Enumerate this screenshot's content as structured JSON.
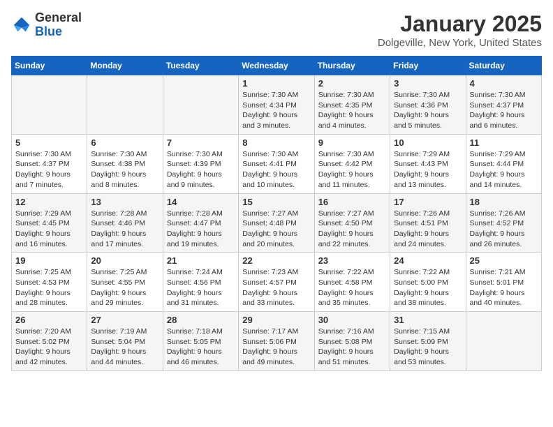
{
  "header": {
    "logo_general": "General",
    "logo_blue": "Blue",
    "month_title": "January 2025",
    "location": "Dolgeville, New York, United States"
  },
  "days_of_week": [
    "Sunday",
    "Monday",
    "Tuesday",
    "Wednesday",
    "Thursday",
    "Friday",
    "Saturday"
  ],
  "weeks": [
    [
      {
        "num": "",
        "info": ""
      },
      {
        "num": "",
        "info": ""
      },
      {
        "num": "",
        "info": ""
      },
      {
        "num": "1",
        "info": "Sunrise: 7:30 AM\nSunset: 4:34 PM\nDaylight: 9 hours and 3 minutes."
      },
      {
        "num": "2",
        "info": "Sunrise: 7:30 AM\nSunset: 4:35 PM\nDaylight: 9 hours and 4 minutes."
      },
      {
        "num": "3",
        "info": "Sunrise: 7:30 AM\nSunset: 4:36 PM\nDaylight: 9 hours and 5 minutes."
      },
      {
        "num": "4",
        "info": "Sunrise: 7:30 AM\nSunset: 4:37 PM\nDaylight: 9 hours and 6 minutes."
      }
    ],
    [
      {
        "num": "5",
        "info": "Sunrise: 7:30 AM\nSunset: 4:37 PM\nDaylight: 9 hours and 7 minutes."
      },
      {
        "num": "6",
        "info": "Sunrise: 7:30 AM\nSunset: 4:38 PM\nDaylight: 9 hours and 8 minutes."
      },
      {
        "num": "7",
        "info": "Sunrise: 7:30 AM\nSunset: 4:39 PM\nDaylight: 9 hours and 9 minutes."
      },
      {
        "num": "8",
        "info": "Sunrise: 7:30 AM\nSunset: 4:41 PM\nDaylight: 9 hours and 10 minutes."
      },
      {
        "num": "9",
        "info": "Sunrise: 7:30 AM\nSunset: 4:42 PM\nDaylight: 9 hours and 11 minutes."
      },
      {
        "num": "10",
        "info": "Sunrise: 7:29 AM\nSunset: 4:43 PM\nDaylight: 9 hours and 13 minutes."
      },
      {
        "num": "11",
        "info": "Sunrise: 7:29 AM\nSunset: 4:44 PM\nDaylight: 9 hours and 14 minutes."
      }
    ],
    [
      {
        "num": "12",
        "info": "Sunrise: 7:29 AM\nSunset: 4:45 PM\nDaylight: 9 hours and 16 minutes."
      },
      {
        "num": "13",
        "info": "Sunrise: 7:28 AM\nSunset: 4:46 PM\nDaylight: 9 hours and 17 minutes."
      },
      {
        "num": "14",
        "info": "Sunrise: 7:28 AM\nSunset: 4:47 PM\nDaylight: 9 hours and 19 minutes."
      },
      {
        "num": "15",
        "info": "Sunrise: 7:27 AM\nSunset: 4:48 PM\nDaylight: 9 hours and 20 minutes."
      },
      {
        "num": "16",
        "info": "Sunrise: 7:27 AM\nSunset: 4:50 PM\nDaylight: 9 hours and 22 minutes."
      },
      {
        "num": "17",
        "info": "Sunrise: 7:26 AM\nSunset: 4:51 PM\nDaylight: 9 hours and 24 minutes."
      },
      {
        "num": "18",
        "info": "Sunrise: 7:26 AM\nSunset: 4:52 PM\nDaylight: 9 hours and 26 minutes."
      }
    ],
    [
      {
        "num": "19",
        "info": "Sunrise: 7:25 AM\nSunset: 4:53 PM\nDaylight: 9 hours and 28 minutes."
      },
      {
        "num": "20",
        "info": "Sunrise: 7:25 AM\nSunset: 4:55 PM\nDaylight: 9 hours and 29 minutes."
      },
      {
        "num": "21",
        "info": "Sunrise: 7:24 AM\nSunset: 4:56 PM\nDaylight: 9 hours and 31 minutes."
      },
      {
        "num": "22",
        "info": "Sunrise: 7:23 AM\nSunset: 4:57 PM\nDaylight: 9 hours and 33 minutes."
      },
      {
        "num": "23",
        "info": "Sunrise: 7:22 AM\nSunset: 4:58 PM\nDaylight: 9 hours and 35 minutes."
      },
      {
        "num": "24",
        "info": "Sunrise: 7:22 AM\nSunset: 5:00 PM\nDaylight: 9 hours and 38 minutes."
      },
      {
        "num": "25",
        "info": "Sunrise: 7:21 AM\nSunset: 5:01 PM\nDaylight: 9 hours and 40 minutes."
      }
    ],
    [
      {
        "num": "26",
        "info": "Sunrise: 7:20 AM\nSunset: 5:02 PM\nDaylight: 9 hours and 42 minutes."
      },
      {
        "num": "27",
        "info": "Sunrise: 7:19 AM\nSunset: 5:04 PM\nDaylight: 9 hours and 44 minutes."
      },
      {
        "num": "28",
        "info": "Sunrise: 7:18 AM\nSunset: 5:05 PM\nDaylight: 9 hours and 46 minutes."
      },
      {
        "num": "29",
        "info": "Sunrise: 7:17 AM\nSunset: 5:06 PM\nDaylight: 9 hours and 49 minutes."
      },
      {
        "num": "30",
        "info": "Sunrise: 7:16 AM\nSunset: 5:08 PM\nDaylight: 9 hours and 51 minutes."
      },
      {
        "num": "31",
        "info": "Sunrise: 7:15 AM\nSunset: 5:09 PM\nDaylight: 9 hours and 53 minutes."
      },
      {
        "num": "",
        "info": ""
      }
    ]
  ]
}
